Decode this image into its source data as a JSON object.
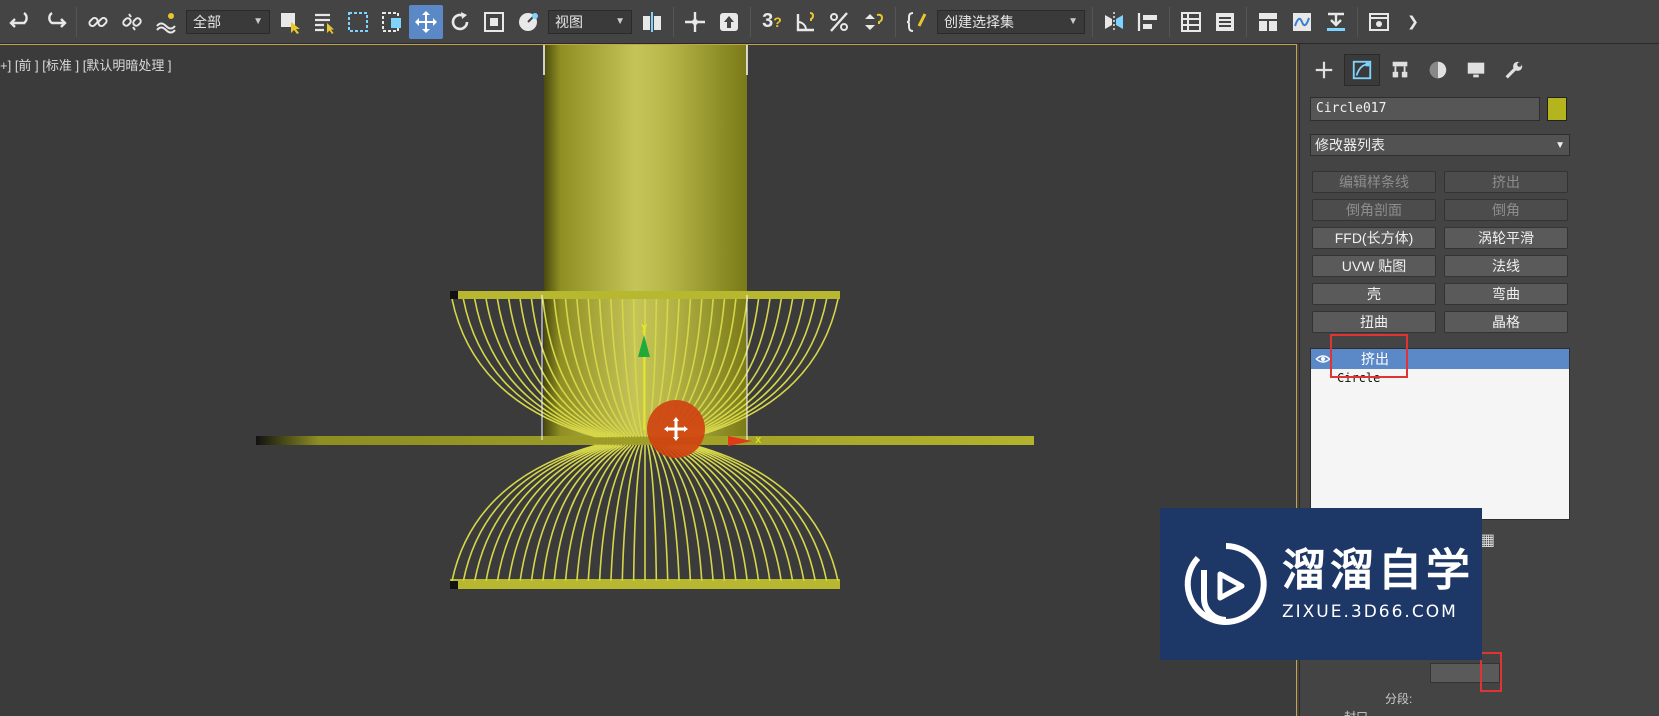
{
  "toolbar": {
    "selection_filter": "全部",
    "reference_coord": "视图",
    "selection_set": "创建选择集",
    "snap_label": "3"
  },
  "viewport": {
    "label": "+] [前 ] [标准 ] [默认明暗处理 ]"
  },
  "panel": {
    "object_name": "Circle017",
    "object_color": "#b4b41e",
    "modifier_list": "修改器列表",
    "modifier_buttons": [
      {
        "label": "编辑样条线",
        "enabled": false
      },
      {
        "label": "挤出",
        "enabled": false
      },
      {
        "label": "倒角剖面",
        "enabled": false
      },
      {
        "label": "倒角",
        "enabled": false
      },
      {
        "label": "FFD(长方体)",
        "enabled": true
      },
      {
        "label": "涡轮平滑",
        "enabled": true
      },
      {
        "label": "UVW 贴图",
        "enabled": true
      },
      {
        "label": "法线",
        "enabled": true
      },
      {
        "label": "壳",
        "enabled": true
      },
      {
        "label": "弯曲",
        "enabled": true
      },
      {
        "label": "扭曲",
        "enabled": true
      },
      {
        "label": "晶格",
        "enabled": true
      }
    ],
    "stack": {
      "selected": "挤出",
      "base": "Circle"
    },
    "lower": {
      "label_segments": "分段:",
      "label_cap": "封口"
    }
  },
  "watermark": {
    "title": "溜溜自学",
    "subtitle": "ZIXUE.3D66.COM"
  }
}
